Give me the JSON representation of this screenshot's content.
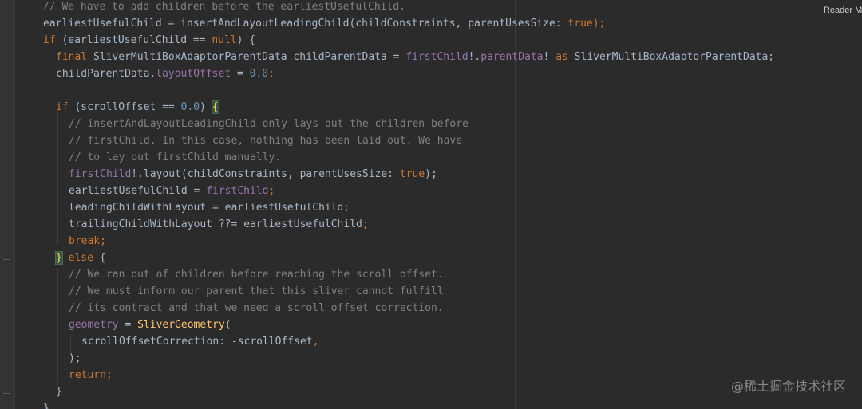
{
  "reader_mode_label": "Reader M",
  "watermark": "@稀土掘金技术社区",
  "colors": {
    "background": "#2b2b2b",
    "keyword": "#cc7832",
    "comment": "#808080",
    "field": "#9876aa",
    "number": "#6897bb",
    "class": "#ffc66d",
    "default": "#a9b7c6"
  },
  "code": {
    "l1": "// We have to add children before the earliestUsefulChild.",
    "l2a": "earliestUsefulChild = insertAndLayoutLeadingChild(childConstraints, parentUsesSize: ",
    "l2b": "true",
    "l2c": ");",
    "l3a": "if",
    "l3b": " (earliestUsefulChild == ",
    "l3c": "null",
    "l3d": ") {",
    "l4a": "final",
    "l4b": " SliverMultiBoxAdaptorParentData childParentData = ",
    "l4c": "firstChild",
    "l4d": "!.",
    "l4e": "parentData",
    "l4f": "! ",
    "l4g": "as",
    "l4h": " SliverMultiBoxAdaptorParentData;",
    "l5a": "childParentData.",
    "l5b": "layoutOffset",
    "l5c": " = ",
    "l5d": "0.0",
    "l5e": ";",
    "l7a": "if",
    "l7b": " (scrollOffset == ",
    "l7c": "0.0",
    "l7d": ") ",
    "l7e": "{",
    "l8": "// insertAndLayoutLeadingChild only lays out the children before",
    "l9": "// firstChild. In this case, nothing has been laid out. We have",
    "l10": "// to lay out firstChild manually.",
    "l11a": "firstChild",
    "l11b": "!.layout(childConstraints, parentUsesSize: ",
    "l11c": "true",
    "l11d": ");",
    "l12a": "earliestUsefulChild = ",
    "l12b": "firstChild",
    "l12c": ";",
    "l13a": "leadingChildWithLayout = earliestUsefulChild",
    "l13b": ";",
    "l14a": "trailingChildWithLayout ??= earliestUsefulChild",
    "l14b": ";",
    "l15a": "break",
    "l15b": ";",
    "l16a": "}",
    "l16b": " else",
    "l16c": " {",
    "l17": "// We ran out of children before reaching the scroll offset.",
    "l18": "// We must inform our parent that this sliver cannot fulfill",
    "l19": "// its contract and that we need a scroll offset correction.",
    "l20a": "geometry",
    "l20b": " = ",
    "l20c": "SliverGeometry",
    "l20d": "(",
    "l21a": "scrollOffsetCorrection: -scrollOffset",
    "l21b": ",",
    "l22": ");",
    "l23a": "return",
    "l23b": ";",
    "l24": "}",
    "l25": "}"
  }
}
